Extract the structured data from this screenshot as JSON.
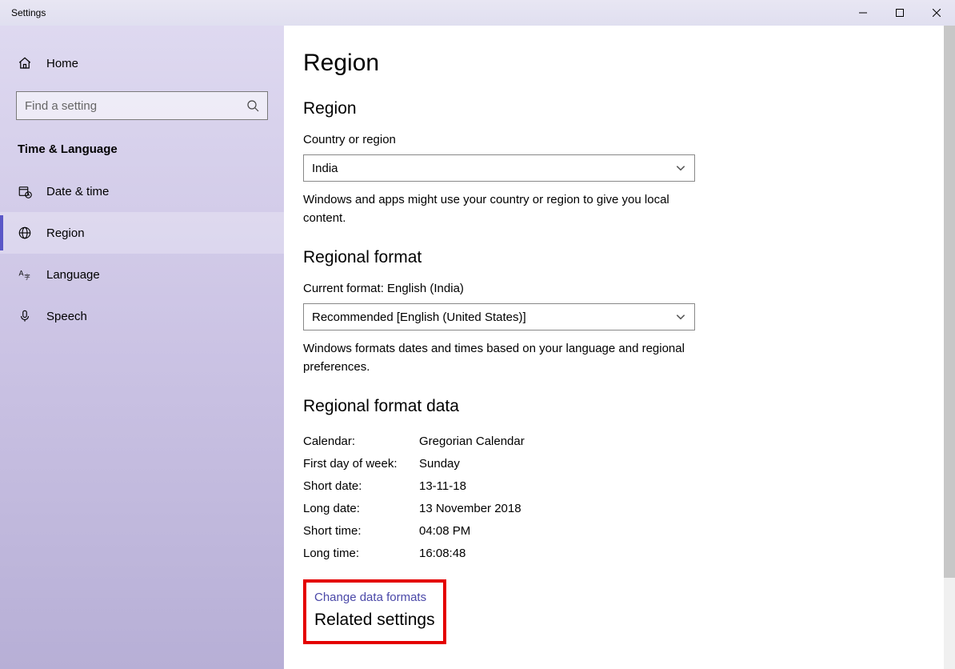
{
  "title": "Settings",
  "sidebar": {
    "home": "Home",
    "search_placeholder": "Find a setting",
    "section": "Time & Language",
    "items": [
      {
        "label": "Date & time"
      },
      {
        "label": "Region"
      },
      {
        "label": "Language"
      },
      {
        "label": "Speech"
      }
    ]
  },
  "main": {
    "title": "Region",
    "region_section": {
      "heading": "Region",
      "label": "Country or region",
      "value": "India",
      "desc": "Windows and apps might use your country or region to give you local content."
    },
    "format_section": {
      "heading": "Regional format",
      "current_label": "Current format: English (India)",
      "value": "Recommended [English (United States)]",
      "desc": "Windows formats dates and times based on your language and regional preferences."
    },
    "data_section": {
      "heading": "Regional format data",
      "rows": [
        {
          "k": "Calendar:",
          "v": "Gregorian Calendar"
        },
        {
          "k": "First day of week:",
          "v": "Sunday"
        },
        {
          "k": "Short date:",
          "v": "13-11-18"
        },
        {
          "k": "Long date:",
          "v": "13 November 2018"
        },
        {
          "k": "Short time:",
          "v": "04:08 PM"
        },
        {
          "k": "Long time:",
          "v": "16:08:48"
        }
      ],
      "link": "Change data formats"
    },
    "related_heading": "Related settings"
  }
}
